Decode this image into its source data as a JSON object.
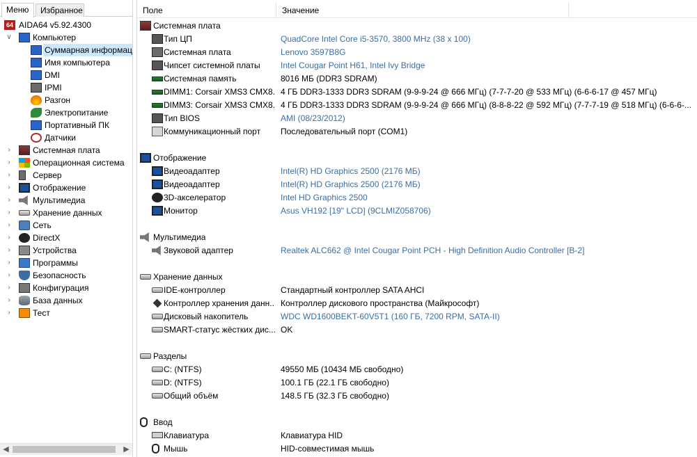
{
  "left": {
    "tabs": [
      {
        "label": "Меню",
        "active": true
      },
      {
        "label": "Избранное",
        "active": false
      }
    ],
    "tree": [
      {
        "label": "AIDA64 v5.92.4300",
        "icon": "aida64-logo-icon",
        "level": 0,
        "expander": ""
      },
      {
        "label": "Компьютер",
        "icon": "computer-icon",
        "level": 0,
        "expander": "expanded"
      },
      {
        "label": "Суммарная информация",
        "icon": "computer-summary-icon",
        "level": 1,
        "expander": "",
        "selected": true
      },
      {
        "label": "Имя компьютера",
        "icon": "computer-name-icon",
        "level": 1,
        "expander": ""
      },
      {
        "label": "DMI",
        "icon": "dmi-icon",
        "level": 1,
        "expander": ""
      },
      {
        "label": "IPMI",
        "icon": "ipmi-icon",
        "level": 1,
        "expander": ""
      },
      {
        "label": "Разгон",
        "icon": "overclock-fire-icon",
        "level": 1,
        "expander": ""
      },
      {
        "label": "Электропитание",
        "icon": "power-icon",
        "level": 1,
        "expander": ""
      },
      {
        "label": "Портативный ПК",
        "icon": "laptop-icon",
        "level": 1,
        "expander": ""
      },
      {
        "label": "Датчики",
        "icon": "sensor-icon",
        "level": 1,
        "expander": ""
      },
      {
        "label": "Системная плата",
        "icon": "motherboard-icon",
        "level": 0,
        "expander": "collapsed"
      },
      {
        "label": "Операционная система",
        "icon": "windows-icon",
        "level": 0,
        "expander": "collapsed"
      },
      {
        "label": "Сервер",
        "icon": "server-icon",
        "level": 0,
        "expander": "collapsed"
      },
      {
        "label": "Отображение",
        "icon": "monitor-icon",
        "level": 0,
        "expander": "collapsed"
      },
      {
        "label": "Мультимедиа",
        "icon": "speaker-icon",
        "level": 0,
        "expander": "collapsed"
      },
      {
        "label": "Хранение данных",
        "icon": "storage-icon",
        "level": 0,
        "expander": "collapsed"
      },
      {
        "label": "Сеть",
        "icon": "network-icon",
        "level": 0,
        "expander": "collapsed"
      },
      {
        "label": "DirectX",
        "icon": "directx-icon",
        "level": 0,
        "expander": "collapsed"
      },
      {
        "label": "Устройства",
        "icon": "devices-icon",
        "level": 0,
        "expander": "collapsed"
      },
      {
        "label": "Программы",
        "icon": "programs-icon",
        "level": 0,
        "expander": "collapsed"
      },
      {
        "label": "Безопасность",
        "icon": "security-icon",
        "level": 0,
        "expander": "collapsed"
      },
      {
        "label": "Конфигурация",
        "icon": "config-icon",
        "level": 0,
        "expander": "collapsed"
      },
      {
        "label": "База данных",
        "icon": "database-icon",
        "level": 0,
        "expander": "collapsed"
      },
      {
        "label": "Тест",
        "icon": "benchmark-icon",
        "level": 0,
        "expander": "collapsed"
      }
    ]
  },
  "right": {
    "columns": {
      "field": "Поле",
      "value": "Значение"
    },
    "groups": [
      {
        "title": "Системная плата",
        "icon": "motherboard-icon",
        "items": [
          {
            "field": "Тип ЦП",
            "value": "QuadCore Intel Core i5-3570, 3800 MHz (38 x 100)",
            "link": true,
            "icon": "cpu-icon"
          },
          {
            "field": "Системная плата",
            "value": "Lenovo 3597B8G",
            "link": true,
            "icon": "board-icon"
          },
          {
            "field": "Чипсет системной платы",
            "value": "Intel Cougar Point H61, Intel Ivy Bridge",
            "link": true,
            "icon": "chipset-icon"
          },
          {
            "field": "Системная память",
            "value": "8016 МБ  (DDR3 SDRAM)",
            "link": false,
            "icon": "ram-icon"
          },
          {
            "field": "DIMM1: Corsair XMS3 CMX8...",
            "value": "4 ГБ DDR3-1333 DDR3 SDRAM  (9-9-9-24 @ 666 МГц)  (7-7-7-20 @ 533 МГц)  (6-6-6-17 @ 457 МГц)",
            "link": false,
            "icon": "ram-icon"
          },
          {
            "field": "DIMM3: Corsair XMS3 CMX8...",
            "value": "4 ГБ DDR3-1333 DDR3 SDRAM  (9-9-9-24 @ 666 МГц)  (8-8-8-22 @ 592 МГц)  (7-7-7-19 @ 518 МГц)  (6-6-6-...",
            "link": false,
            "icon": "ram-icon"
          },
          {
            "field": "Тип BIOS",
            "value": "AMI (08/23/2012)",
            "link": true,
            "icon": "bios-icon"
          },
          {
            "field": "Коммуникационный порт",
            "value": "Последовательный порт (COM1)",
            "link": false,
            "icon": "port-icon"
          }
        ]
      },
      {
        "title": "Отображение",
        "icon": "monitor-icon",
        "items": [
          {
            "field": "Видеоадаптер",
            "value": "Intel(R) HD Graphics 2500  (2176 МБ)",
            "link": true,
            "icon": "monitor-icon"
          },
          {
            "field": "Видеоадаптер",
            "value": "Intel(R) HD Graphics 2500  (2176 МБ)",
            "link": true,
            "icon": "monitor-icon"
          },
          {
            "field": "3D-акселератор",
            "value": "Intel HD Graphics 2500",
            "link": true,
            "icon": "directx-icon"
          },
          {
            "field": "Монитор",
            "value": "Asus VH192  [19\" LCD]  (9CLMIZ058706)",
            "link": true,
            "icon": "monitor-icon"
          }
        ]
      },
      {
        "title": "Мультимедиа",
        "icon": "speaker-icon",
        "items": [
          {
            "field": "Звуковой адаптер",
            "value": "Realtek ALC662 @ Intel Cougar Point PCH - High Definition Audio Controller [B-2]",
            "link": true,
            "icon": "speaker-icon"
          }
        ]
      },
      {
        "title": "Хранение данных",
        "icon": "storage-icon",
        "items": [
          {
            "field": "IDE-контроллер",
            "value": "Стандартный контроллер SATA AHCI",
            "link": false,
            "icon": "drive-icon"
          },
          {
            "field": "Контроллер хранения данн...",
            "value": "Контроллер дискового пространства (Майкрософт)",
            "link": false,
            "icon": "storage-controller-icon"
          },
          {
            "field": "Дисковый накопитель",
            "value": "WDC WD1600BEKT-60V5T1  (160 ГБ, 7200 RPM, SATA-II)",
            "link": true,
            "icon": "drive-icon"
          },
          {
            "field": "SMART-статус жёстких дис...",
            "value": "OK",
            "link": false,
            "icon": "drive-icon"
          }
        ]
      },
      {
        "title": "Разделы",
        "icon": "drive-icon",
        "items": [
          {
            "field": "C: (NTFS)",
            "value": "49550 МБ (10434 МБ свободно)",
            "link": false,
            "icon": "drive-icon"
          },
          {
            "field": "D: (NTFS)",
            "value": "100.1 ГБ (22.1 ГБ свободно)",
            "link": false,
            "icon": "drive-icon"
          },
          {
            "field": "Общий объём",
            "value": "148.5 ГБ (32.3 ГБ свободно)",
            "link": false,
            "icon": "drive-icon"
          }
        ]
      },
      {
        "title": "Ввод",
        "icon": "mouse-icon",
        "items": [
          {
            "field": "Клавиатура",
            "value": "Клавиатура HID",
            "link": false,
            "icon": "keyboard-icon"
          },
          {
            "field": "Мышь",
            "value": "HID-совместимая мышь",
            "link": false,
            "icon": "mouse-icon"
          }
        ]
      }
    ]
  },
  "colors": {
    "link": "#3a6ea5",
    "selection": "#cce8ff"
  }
}
